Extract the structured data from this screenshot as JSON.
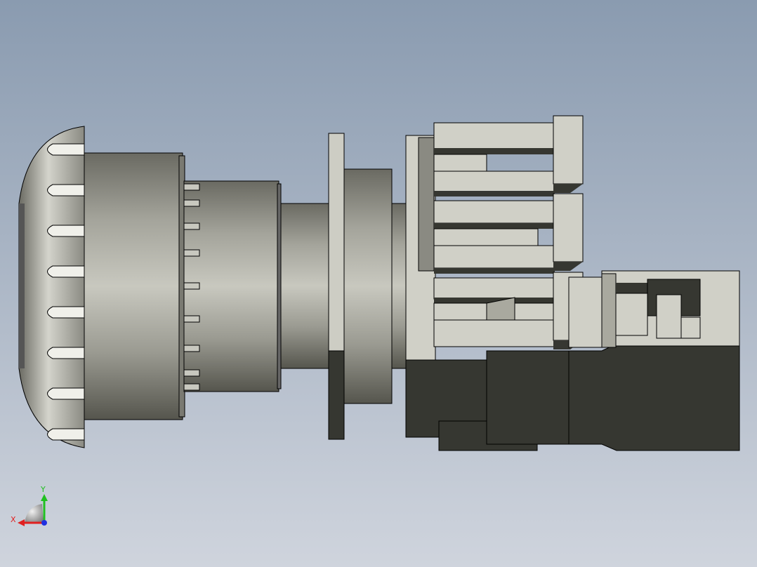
{
  "viewport": {
    "background_top": "#8a9bb0",
    "background_bottom": "#cfd4dd"
  },
  "model": {
    "colors": {
      "knob_light": "#c9c9c1",
      "knob_dark": "#55554d",
      "body_light": "#d2d2c8",
      "body_mid": "#a8a89f",
      "dark": "#363731",
      "outline": "#000000",
      "panel": "#cdcdc4"
    },
    "grip_ridge_count": 8
  },
  "triad": {
    "x_label": "X",
    "y_label": "Y",
    "x_color": "#e02020",
    "y_color": "#20c020",
    "z_color": "#2030e0"
  }
}
